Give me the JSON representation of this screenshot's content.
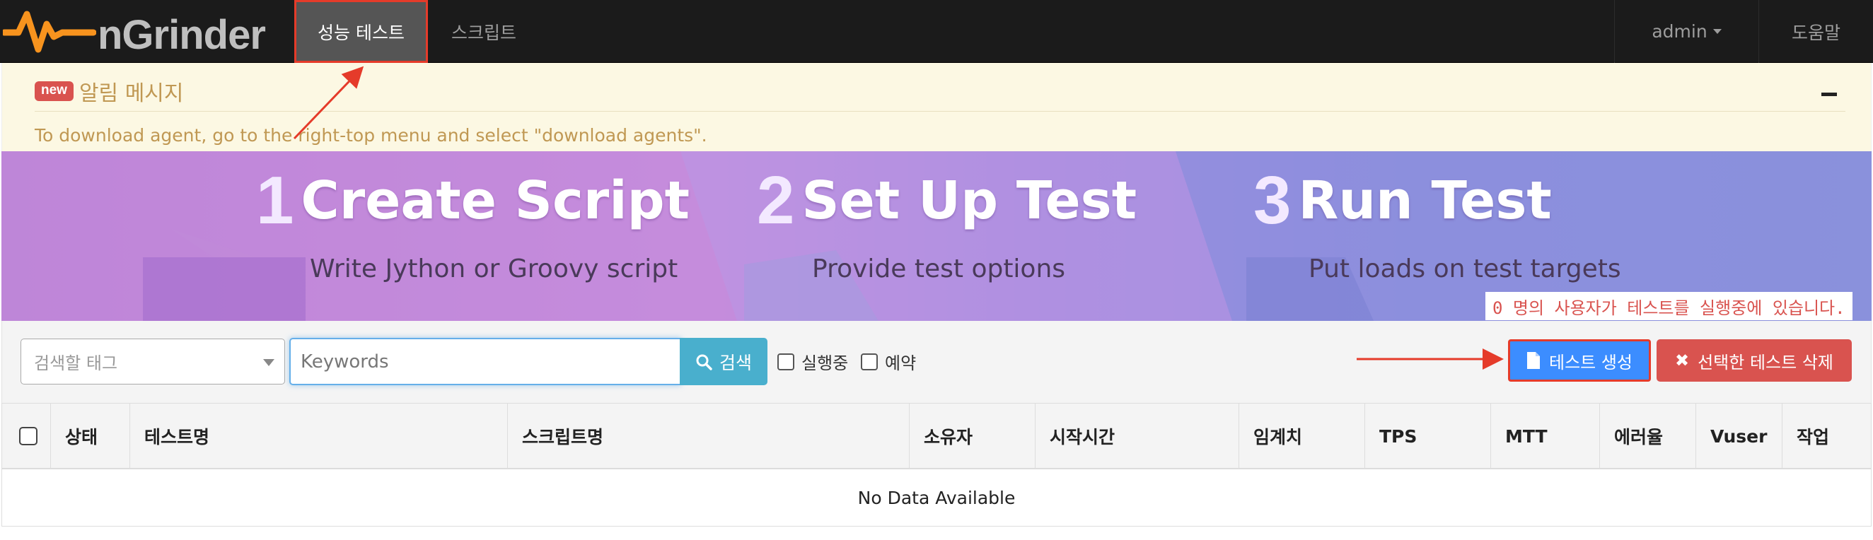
{
  "brand": {
    "name": "nGrinder",
    "logo_color": "#f7931e"
  },
  "nav": {
    "performance_test": "성능 테스트",
    "script": "스크립트",
    "user": "admin",
    "help": "도움말"
  },
  "alert": {
    "badge": "new",
    "title": "알림 메시지",
    "message": "To download agent, go to the right-top menu and select \"download agents\"."
  },
  "banner": {
    "steps": [
      {
        "num": "1",
        "title": "Create Script",
        "subtitle": "Write Jython or Groovy script"
      },
      {
        "num": "2",
        "title": "Set Up Test",
        "subtitle": "Provide test options"
      },
      {
        "num": "3",
        "title": "Run Test",
        "subtitle": "Put loads on test targets"
      }
    ],
    "running_info": "0 명의 사용자가 테스트를 실행중에 있습니다."
  },
  "toolbar": {
    "tag_placeholder": "검색할 태그",
    "keyword_placeholder": "Keywords",
    "search_label": "검색",
    "running_label": "실행중",
    "scheduled_label": "예약",
    "create_label": "테스트 생성",
    "delete_label": "선택한 테스트 삭제"
  },
  "table": {
    "columns": [
      "상태",
      "테스트명",
      "스크립트명",
      "소유자",
      "시작시간",
      "임계치",
      "TPS",
      "MTT",
      "에러율",
      "Vuser",
      "작업"
    ],
    "empty": "No Data Available"
  },
  "colors": {
    "annotation": "#e53b2a",
    "primary": "#3c8dff",
    "danger": "#d9534f",
    "info": "#49afcd"
  }
}
